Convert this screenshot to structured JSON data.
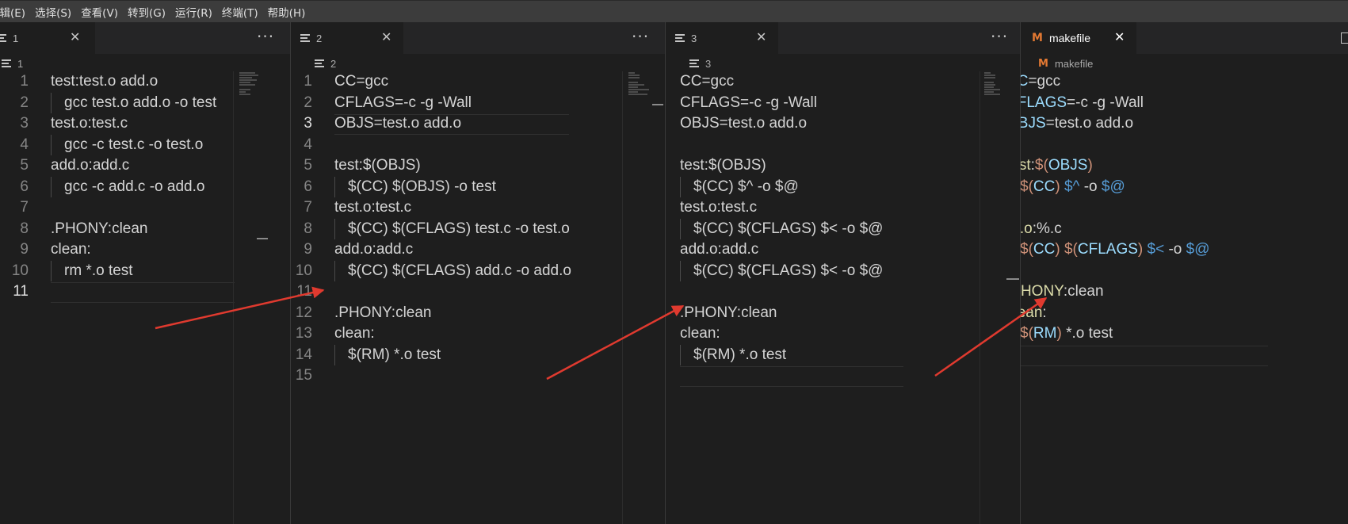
{
  "menubar": [
    "编辑(E)",
    "选择(S)",
    "查看(V)",
    "转到(G)",
    "运行(R)",
    "终端(T)",
    "帮助(H)"
  ],
  "panes": [
    {
      "tab_label": "1",
      "crumb": "1",
      "active_line": 11,
      "lines": [
        "test:test.o add.o",
        "    gcc test.o add.o -o test",
        "test.o:test.c",
        "    gcc -c test.c -o test.o",
        "add.o:add.c",
        "    gcc -c add.c -o add.o",
        "",
        ".PHONY:clean",
        "clean:",
        "    rm *.o test",
        ""
      ]
    },
    {
      "tab_label": "2",
      "crumb": "2",
      "active_line": 3,
      "lines": [
        "CC=gcc",
        "CFLAGS=-c -g -Wall",
        "OBJS=test.o add.o",
        "",
        "test:$(OBJS)",
        "    $(CC) $(OBJS) -o test",
        "test.o:test.c",
        "    $(CC) $(CFLAGS) test.c -o test.o",
        "add.o:add.c",
        "    $(CC) $(CFLAGS) add.c -o add.o",
        "",
        ".PHONY:clean",
        "clean:",
        "    $(RM) *.o test",
        ""
      ]
    },
    {
      "tab_label": "3",
      "crumb": "3",
      "active_line": 15,
      "lines": [
        "CC=gcc",
        "CFLAGS=-c -g -Wall",
        "OBJS=test.o add.o",
        "",
        "test:$(OBJS)",
        "    $(CC) $^ -o $@",
        "test.o:test.c",
        "    $(CC) $(CFLAGS) $< -o $@",
        "add.o:add.c",
        "    $(CC) $(CFLAGS) $< -o $@",
        "",
        ".PHONY:clean",
        "clean:",
        "    $(RM) *.o test",
        ""
      ]
    },
    {
      "tab_label": "makefile",
      "crumb": "makefile",
      "active_line": 14,
      "lines": [
        "CC=gcc",
        "CFLAGS=-c -g -Wall",
        "OBJS=test.o add.o",
        "",
        "test:$(OBJS)",
        "    $(CC) $^ -o $@",
        "",
        "%.o:%.c",
        "    $(CC) $(CFLAGS) $< -o $@",
        "",
        ".PHONY:clean",
        "clean:",
        "    $(RM) *.o test",
        ""
      ]
    }
  ],
  "icons": {
    "file_icon": "lines-icon",
    "makefile_icon": "M",
    "close_icon": "×",
    "more_icon": "···"
  },
  "colors": {
    "editor_bg": "#1e1e1e",
    "tabbar_bg": "#252526",
    "arrow": "#e03a2f",
    "makefile_icon": "#e37933"
  }
}
